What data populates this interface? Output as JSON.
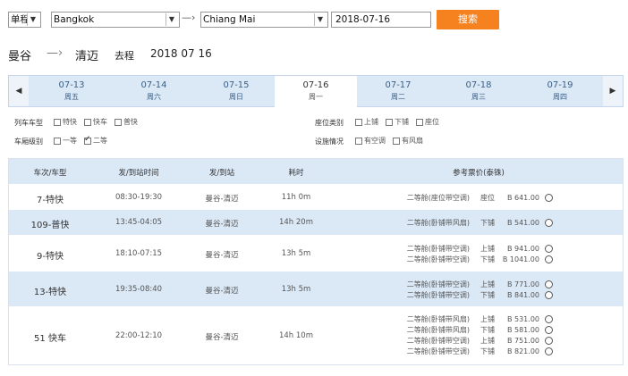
{
  "search": {
    "trip_type": "单程",
    "from_value": "Bangkok",
    "arrow": "—›",
    "to_value": "Chiang Mai",
    "date_value": "2018-07-16",
    "button_label": "搜索"
  },
  "route": {
    "from": "曼谷",
    "arrow": "—›",
    "to": "清迈",
    "direction": "去程",
    "date": "2018 07 16"
  },
  "date_strip": {
    "prev": "◀",
    "next": "▶",
    "dates": [
      {
        "date": "07-13",
        "weekday": "周五",
        "active": false
      },
      {
        "date": "07-14",
        "weekday": "周六",
        "active": false
      },
      {
        "date": "07-15",
        "weekday": "周日",
        "active": false
      },
      {
        "date": "07-16",
        "weekday": "周一",
        "active": true
      },
      {
        "date": "07-17",
        "weekday": "周二",
        "active": false
      },
      {
        "date": "07-18",
        "weekday": "周三",
        "active": false
      },
      {
        "date": "07-19",
        "weekday": "周四",
        "active": false
      }
    ]
  },
  "filters": {
    "train_type": {
      "label": "列车车型",
      "options": [
        {
          "label": "特快",
          "checked": false
        },
        {
          "label": "快车",
          "checked": false
        },
        {
          "label": "普快",
          "checked": false
        }
      ]
    },
    "car_class": {
      "label": "车厢级别",
      "options": [
        {
          "label": "一等",
          "checked": false
        },
        {
          "label": "二等",
          "checked": true
        }
      ]
    },
    "seat_type": {
      "label": "座位类别",
      "options": [
        {
          "label": "上铺",
          "checked": false
        },
        {
          "label": "下铺",
          "checked": false
        },
        {
          "label": "座位",
          "checked": false
        }
      ]
    },
    "facilities": {
      "label": "设施情况",
      "options": [
        {
          "label": "有空调",
          "checked": false
        },
        {
          "label": "有风扇",
          "checked": false
        }
      ]
    }
  },
  "table": {
    "headers": [
      "车次/车型",
      "发/到站时间",
      "发/到站",
      "耗时",
      "参考票价(泰铢)"
    ],
    "rows": [
      {
        "train": "7-特快",
        "time": "08:30-19:30",
        "stations": "曼谷-清迈",
        "duration": "11h 0m",
        "prices": [
          {
            "class": "二等舱(座位带空调)",
            "seat": "座位",
            "amount": "B 641.00"
          }
        ]
      },
      {
        "train": "109-普快",
        "time": "13:45-04:05",
        "stations": "曼谷-清迈",
        "duration": "14h 20m",
        "prices": [
          {
            "class": "二等舱(卧铺带风扇)",
            "seat": "下铺",
            "amount": "B 541.00"
          }
        ]
      },
      {
        "train": "9-特快",
        "time": "18:10-07:15",
        "stations": "曼谷-清迈",
        "duration": "13h 5m",
        "prices": [
          {
            "class": "二等舱(卧铺带空调)",
            "seat": "上铺",
            "amount": "B 941.00"
          },
          {
            "class": "二等舱(卧铺带空调)",
            "seat": "下铺",
            "amount": "B 1041.00"
          }
        ]
      },
      {
        "train": "13-特快",
        "time": "19:35-08:40",
        "stations": "曼谷-清迈",
        "duration": "13h 5m",
        "prices": [
          {
            "class": "二等舱(卧铺带空调)",
            "seat": "上铺",
            "amount": "B 771.00"
          },
          {
            "class": "二等舱(卧铺带空调)",
            "seat": "下铺",
            "amount": "B 841.00"
          }
        ]
      },
      {
        "train": "51 快车",
        "time": "22:00-12:10",
        "stations": "曼谷-清迈",
        "duration": "14h 10m",
        "prices": [
          {
            "class": "二等舱(卧铺带风扇)",
            "seat": "上铺",
            "amount": "B 531.00"
          },
          {
            "class": "二等舱(卧铺带风扇)",
            "seat": "下铺",
            "amount": "B 581.00"
          },
          {
            "class": "二等舱(卧铺带空调)",
            "seat": "上铺",
            "amount": "B 751.00"
          },
          {
            "class": "二等舱(卧铺带空调)",
            "seat": "下铺",
            "amount": "B 821.00"
          }
        ]
      }
    ]
  },
  "colors": {
    "accent": "#f5821f",
    "row_alt": "#dbe9f7"
  }
}
